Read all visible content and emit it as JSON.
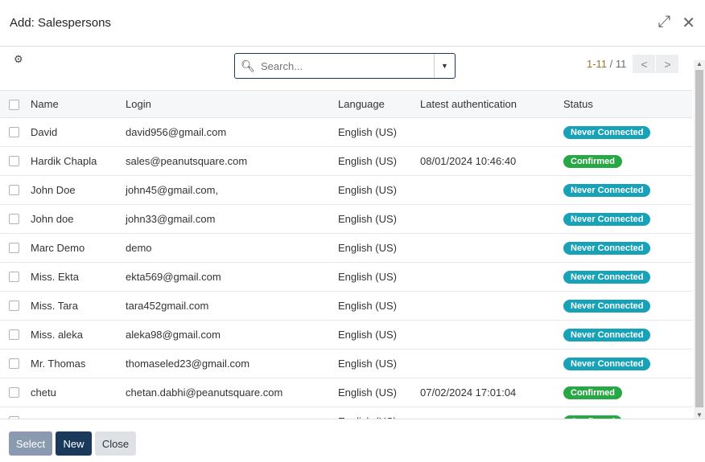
{
  "dialog": {
    "title": "Add: Salespersons"
  },
  "search": {
    "placeholder": "Search..."
  },
  "pager": {
    "range": "1-11",
    "total": "11"
  },
  "columns": [
    "Name",
    "Login",
    "Language",
    "Latest authentication",
    "Status"
  ],
  "colors": {
    "never": "#17a2b8",
    "confirmed": "#28a745",
    "primary": "#1a3a5c"
  },
  "rows": [
    {
      "name": "David",
      "login": "david956@gmail.com",
      "language": "English (US)",
      "auth": "",
      "status": "Never Connected"
    },
    {
      "name": "Hardik Chapla",
      "login": "sales@peanutsquare.com",
      "language": "English (US)",
      "auth": "08/01/2024 10:46:40",
      "status": "Confirmed"
    },
    {
      "name": "John Doe",
      "login": "john45@gmail.com,",
      "language": "English (US)",
      "auth": "",
      "status": "Never Connected"
    },
    {
      "name": "John doe",
      "login": "john33@gmail.com",
      "language": "English (US)",
      "auth": "",
      "status": "Never Connected"
    },
    {
      "name": "Marc Demo",
      "login": "demo",
      "language": "English (US)",
      "auth": "",
      "status": "Never Connected"
    },
    {
      "name": "Miss. Ekta",
      "login": "ekta569@gmail.com",
      "language": "English (US)",
      "auth": "",
      "status": "Never Connected"
    },
    {
      "name": "Miss. Tara",
      "login": "tara452gmail.com",
      "language": "English (US)",
      "auth": "",
      "status": "Never Connected"
    },
    {
      "name": "Miss. aleka",
      "login": "aleka98@gmail.com",
      "language": "English (US)",
      "auth": "",
      "status": "Never Connected"
    },
    {
      "name": "Mr. Thomas",
      "login": "thomaseled23@gmail.com",
      "language": "English (US)",
      "auth": "",
      "status": "Never Connected"
    },
    {
      "name": "chetu",
      "login": "chetan.dabhi@peanutsquare.com",
      "language": "English (US)",
      "auth": "07/02/2024 17:01:04",
      "status": "Confirmed"
    },
    {
      "name": "",
      "login": "",
      "language": "English (US)",
      "auth": "",
      "status": "Confirmed"
    }
  ],
  "footer": {
    "select": "Select",
    "new": "New",
    "close": "Close"
  }
}
